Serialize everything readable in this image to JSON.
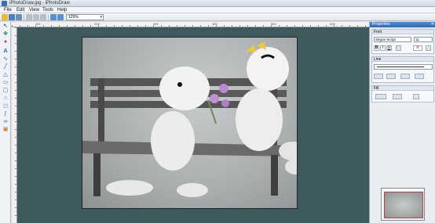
{
  "window": {
    "title": "iPhotoDraw.jpg - iPhotoDraw"
  },
  "menu": [
    "File",
    "Edit",
    "View",
    "Tools",
    "Help"
  ],
  "toolbar": {
    "zoom_value": "125%"
  },
  "ruler": {
    "top_labels": [
      "100",
      "200",
      "300",
      "400",
      "500",
      "600"
    ]
  },
  "properties": {
    "title": "Properties",
    "close": "✕",
    "font": {
      "label": "Font",
      "family": "Segoe Script",
      "size": "11",
      "bold": "B",
      "italic": "I",
      "underline": "U",
      "color_btn": "A"
    },
    "line": {
      "label": "Line"
    },
    "fill": {
      "label": "Fill"
    }
  },
  "colors": {
    "workspace": "#3e5a5c",
    "panel_header": "#2d6bb8",
    "selection": "#d33"
  }
}
